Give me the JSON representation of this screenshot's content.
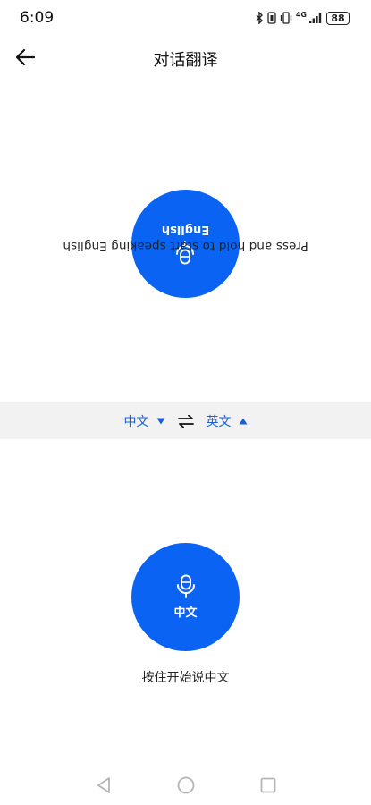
{
  "status_bar": {
    "time": "6:09",
    "network": "4G",
    "battery": "88",
    "icons": [
      "bluetooth-icon",
      "nfc-icon",
      "vibrate-icon",
      "signal-icon",
      "battery-icon"
    ]
  },
  "app_bar": {
    "title": "对话翻译",
    "back_icon": "arrow-left-icon"
  },
  "upper_panel": {
    "prompt": "Press and hold to start speaking English",
    "mic_label": "English",
    "mic_icon": "microphone-icon"
  },
  "language_bar": {
    "source_language": "中文",
    "target_language": "英文",
    "swap_icon": "swap-arrows-icon",
    "accent_color": "#1a5fd6"
  },
  "lower_panel": {
    "mic_label": "中文",
    "prompt": "按住开始说中文",
    "mic_icon": "microphone-icon"
  },
  "nav_bar": {
    "icons": [
      "nav-back-icon",
      "nav-home-icon",
      "nav-recents-icon"
    ]
  },
  "colors": {
    "primary_blue": "#0a63f2",
    "lang_bar_bg": "#f2f2f2"
  }
}
